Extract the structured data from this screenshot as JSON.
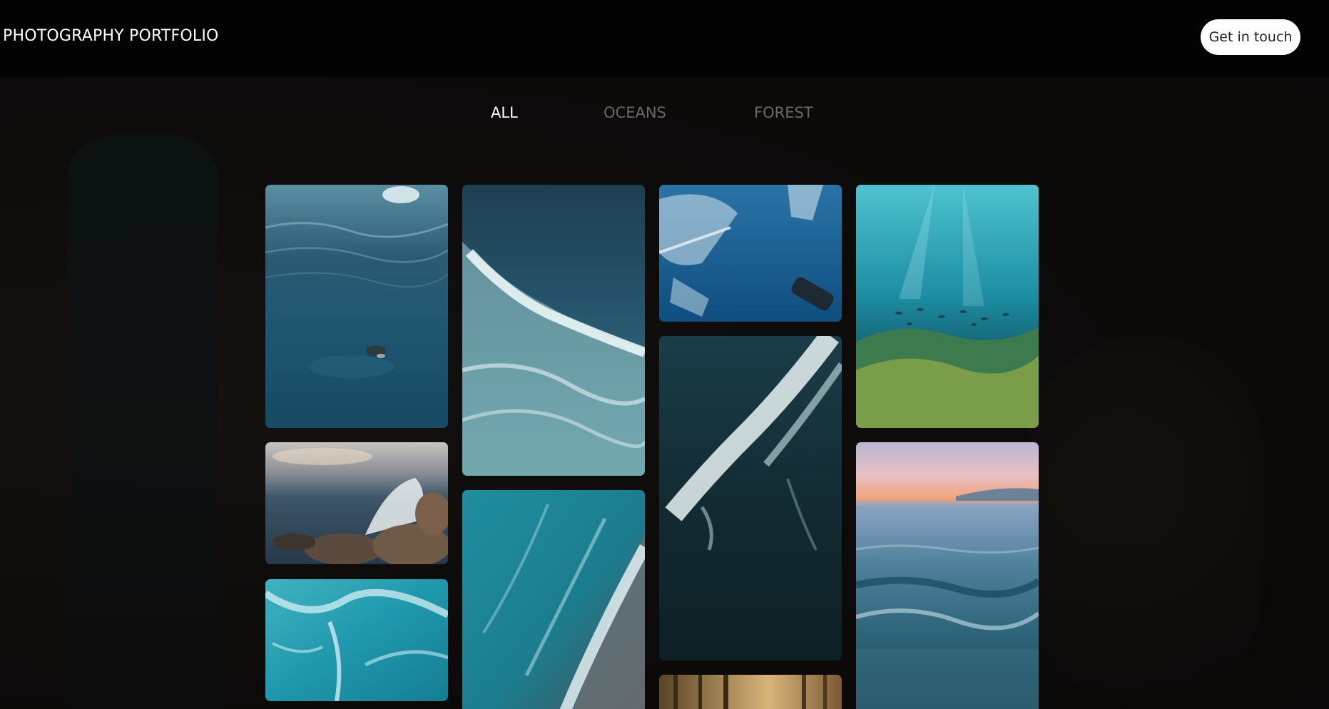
{
  "header": {
    "brand": "PHOTOGRAPHY PORTFOLIO",
    "cta_label": "Get in touch"
  },
  "filters": {
    "items": [
      {
        "label": "ALL",
        "active": true
      },
      {
        "label": "OCEANS",
        "active": false
      },
      {
        "label": "FOREST",
        "active": false
      }
    ]
  },
  "gallery": {
    "photos": [
      {
        "subject": "turtle swimming underwater",
        "category": "oceans"
      },
      {
        "subject": "wave crashing on rocks at sunset",
        "category": "oceans"
      },
      {
        "subject": "turquoise surf aerial",
        "category": "oceans"
      },
      {
        "subject": "breaking wave from above",
        "category": "oceans"
      },
      {
        "subject": "aerial shoreline surf",
        "category": "oceans"
      },
      {
        "subject": "plastic debris in ocean",
        "category": "oceans"
      },
      {
        "subject": "aerial dark sea wave",
        "category": "oceans"
      },
      {
        "subject": "sunlit forest",
        "category": "forest"
      },
      {
        "subject": "coral reef with fish and sun rays",
        "category": "oceans"
      },
      {
        "subject": "sea surface at sunset",
        "category": "oceans"
      }
    ]
  },
  "colors": {
    "header_bg": "#030303",
    "page_bg": "#0b0908",
    "active_filter": "#ffffff",
    "inactive_filter": "#6b6765",
    "cta_bg": "#ffffff"
  }
}
